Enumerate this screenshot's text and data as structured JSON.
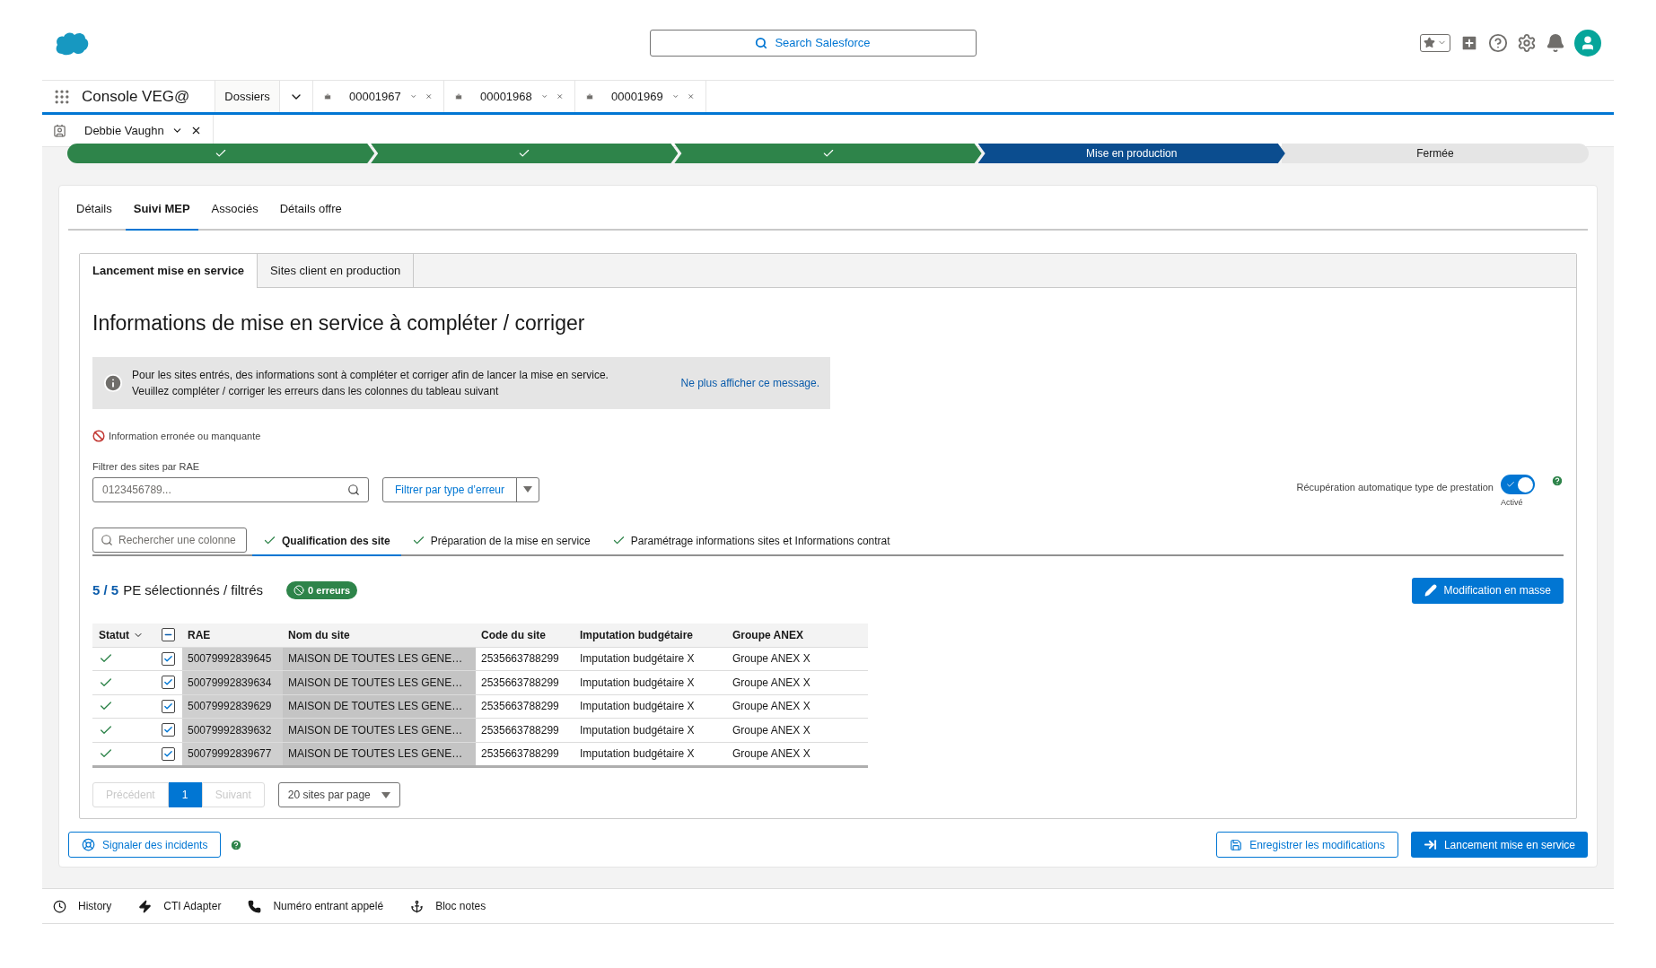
{
  "header": {
    "search_placeholder": "Search Salesforce"
  },
  "app": {
    "name": "Console VEG@",
    "nav_menu": "Dossiers",
    "tabs": [
      {
        "label": "00001967",
        "selected": false
      },
      {
        "label": "00001968",
        "selected": false
      },
      {
        "label": "00001969",
        "selected": false
      }
    ]
  },
  "subtabs": [
    {
      "label": "Debbie Vaughn",
      "selected": true
    }
  ],
  "path": [
    {
      "kind": "complete"
    },
    {
      "kind": "complete"
    },
    {
      "kind": "complete"
    },
    {
      "kind": "current",
      "label": "Mise en production"
    },
    {
      "kind": "incomplete",
      "label": "Fermée"
    }
  ],
  "record_tabs": [
    {
      "label": "Détails",
      "selected": false
    },
    {
      "label": "Suivi MEP",
      "selected": true
    },
    {
      "label": "Associés",
      "selected": false
    },
    {
      "label": "Détails offre",
      "selected": false
    }
  ],
  "section_tabs": [
    {
      "label": "Lancement mise en service",
      "selected": true
    },
    {
      "label": "Sites client en production",
      "selected": false
    }
  ],
  "title": "Informations de mise en service à compléter / corriger",
  "notice": {
    "lines": [
      "Pour les sites entrés, des informations sont à compléter et corriger afin de lancer la mise en service.",
      "Veuillez compléter / corriger les erreurs dans les colonnes du tableau suivant"
    ],
    "link": "Ne plus afficher ce message."
  },
  "legend": "Information erronée ou manquante",
  "filter": {
    "label": "Filtrer des sites par RAE",
    "placeholder": "0123456789...",
    "error_filter": "Filtrer par type d’erreur"
  },
  "auto_toggle": {
    "label": "Récupération automatique type de prestation",
    "on": true,
    "state_label": "Activé"
  },
  "column_search": {
    "placeholder": "Rechercher une colonne"
  },
  "column_groups": [
    {
      "label": "Qualification des site",
      "selected": true,
      "complete": true
    },
    {
      "label": "Préparation de la mise en service",
      "selected": false,
      "complete": true
    },
    {
      "label": "Paramétrage informations sites et Informations contrat",
      "selected": false,
      "complete": true
    }
  ],
  "selection": {
    "count": "5 / 5",
    "text": "PE sélectionnés / filtrés",
    "errors": "0 erreurs"
  },
  "mass_edit": "Modification en masse",
  "table": {
    "columns": [
      "Statut",
      "RAE",
      "Nom du site",
      "Code du site",
      "Imputation budgétaire",
      "Groupe ANEX"
    ],
    "select_all_mixed": true,
    "rows": [
      {
        "valid": true,
        "checked": true,
        "rae": "50079992839645",
        "site_name": "MAISON DE TOUTES LES GENE…",
        "site_code": "2535663788299",
        "imputation": "Imputation budgétaire X",
        "anex_group": "Groupe ANEX X"
      },
      {
        "valid": true,
        "checked": true,
        "rae": "50079992839634",
        "site_name": "MAISON DE TOUTES LES GENE…",
        "site_code": "2535663788299",
        "imputation": "Imputation budgétaire X",
        "anex_group": "Groupe ANEX X"
      },
      {
        "valid": true,
        "checked": true,
        "rae": "50079992839629",
        "site_name": "MAISON DE TOUTES LES GENE…",
        "site_code": "2535663788299",
        "imputation": "Imputation budgétaire X",
        "anex_group": "Groupe ANEX X"
      },
      {
        "valid": true,
        "checked": true,
        "rae": "50079992839632",
        "site_name": "MAISON DE TOUTES LES GENE…",
        "site_code": "2535663788299",
        "imputation": "Imputation budgétaire X",
        "anex_group": "Groupe ANEX X"
      },
      {
        "valid": true,
        "checked": true,
        "rae": "50079992839677",
        "site_name": "MAISON DE TOUTES LES GENE…",
        "site_code": "2535663788299",
        "imputation": "Imputation budgétaire X",
        "anex_group": "Groupe ANEX X"
      }
    ]
  },
  "pagination": {
    "previous": {
      "label": "Précédent",
      "disabled": true
    },
    "pages": [
      {
        "label": "1",
        "selected": true
      }
    ],
    "next": {
      "label": "Suivant",
      "disabled": true
    },
    "page_size": "20 sites par page"
  },
  "footer_actions": {
    "report": "Signaler des incidents",
    "save": "Enregistrer les modifications",
    "launch": "Lancement mise en service"
  },
  "utility_bar": [
    {
      "kind": "history",
      "label": "History"
    },
    {
      "kind": "cti",
      "label": "CTI Adapter"
    },
    {
      "kind": "phone",
      "label": "Numéro entrant appelé"
    },
    {
      "kind": "notes",
      "label": "Bloc notes"
    }
  ]
}
